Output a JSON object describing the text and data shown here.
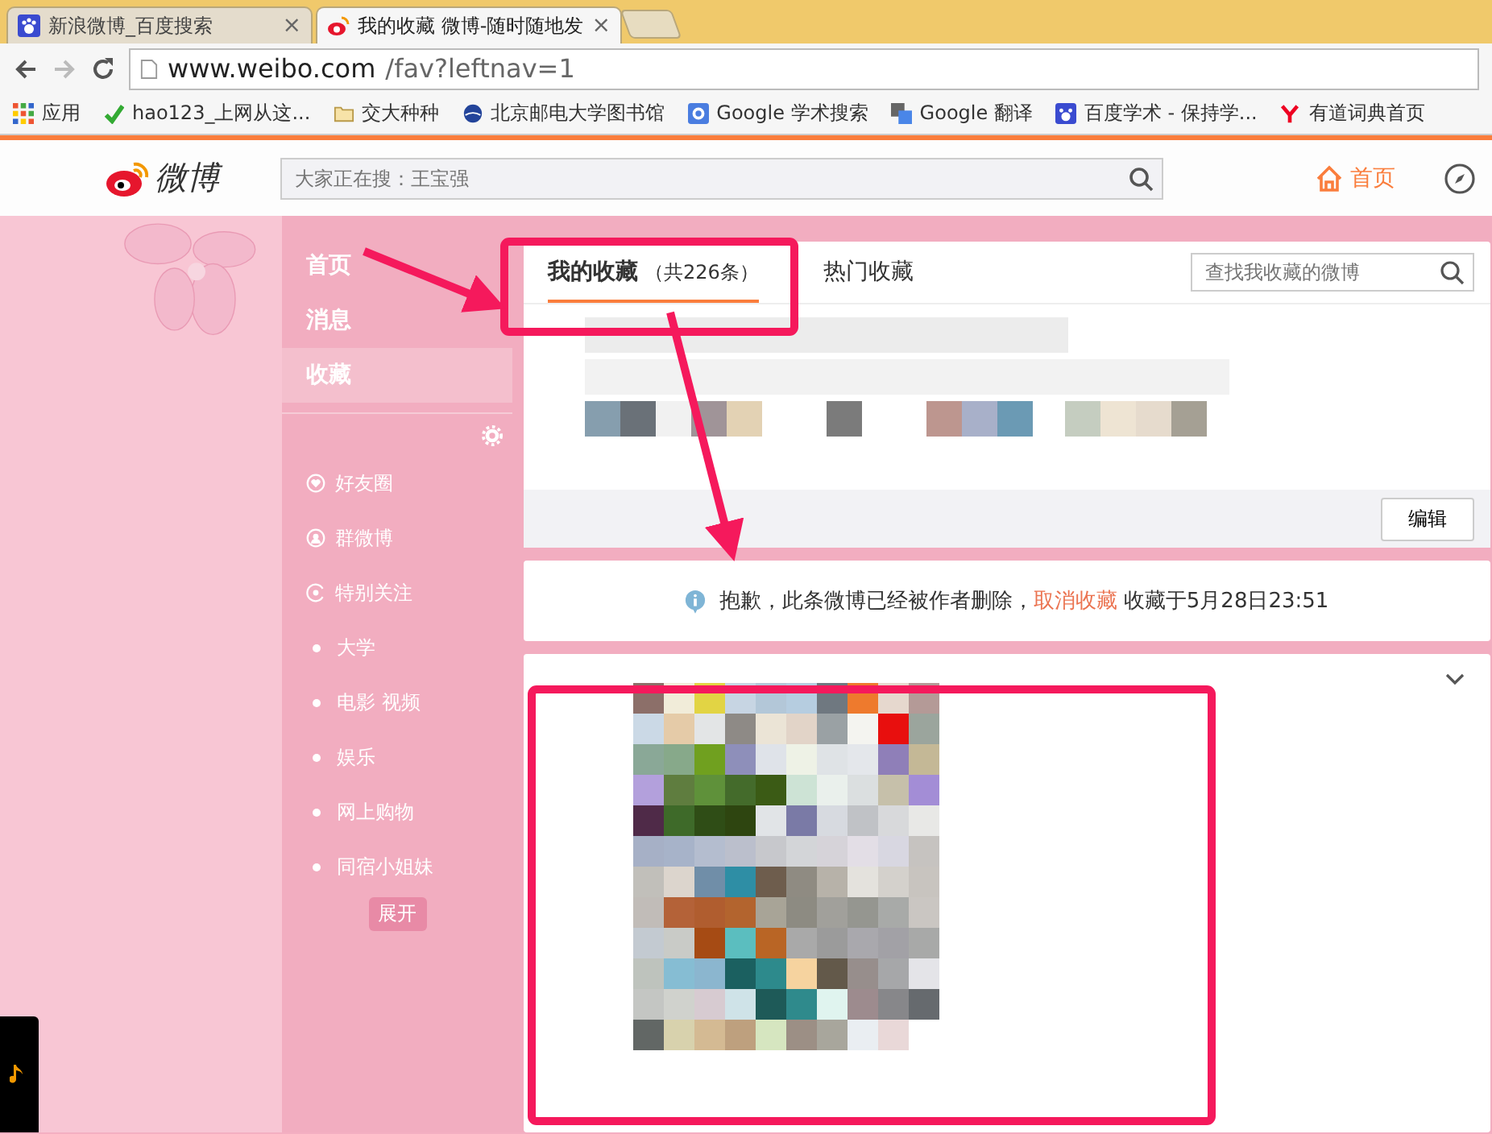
{
  "browser": {
    "tabs": [
      {
        "title": "新浪微博_百度搜索",
        "close": "×",
        "selected": false
      },
      {
        "title": "我的收藏 微博-随时随地发",
        "close": "×",
        "selected": true
      }
    ],
    "url_host": "www.weibo.com",
    "url_path": "/fav?leftnav=1",
    "bookmarks": [
      "应用",
      "hao123_上网从这...",
      "交大种种",
      "北京邮电大学图书馆",
      "Google 学术搜索",
      "Google 翻译",
      "百度学术 - 保持学...",
      "有道词典首页"
    ]
  },
  "header": {
    "logo_text": "微博",
    "search_placeholder": "大家正在搜：王宝强",
    "nav": [
      {
        "label": "首页"
      }
    ]
  },
  "sidebar": {
    "items": [
      {
        "label": "首页",
        "selected": false
      },
      {
        "label": "消息",
        "selected": false
      },
      {
        "label": "收藏",
        "selected": true
      }
    ],
    "groups": [
      {
        "label": "好友圈",
        "kind": "heart"
      },
      {
        "label": "群微博",
        "kind": "person"
      },
      {
        "label": "特别关注",
        "kind": "eye"
      },
      {
        "label": "大学",
        "kind": "dot"
      },
      {
        "label": "电影 视频",
        "kind": "dot"
      },
      {
        "label": "娱乐",
        "kind": "dot"
      },
      {
        "label": "网上购物",
        "kind": "dot"
      },
      {
        "label": "同宿小姐妹",
        "kind": "dot"
      }
    ],
    "expand": "展开"
  },
  "favorites": {
    "tabs": [
      {
        "label": "我的收藏",
        "count": "（共226条）",
        "selected": true
      },
      {
        "label": "热门收藏",
        "selected": false
      }
    ],
    "search_placeholder": "查找我收藏的微博",
    "edit": "编辑"
  },
  "notice": {
    "text": "抱歉，此条微博已经被作者删除，",
    "link": "取消收藏",
    "time": "收藏于5月28日23:51"
  }
}
